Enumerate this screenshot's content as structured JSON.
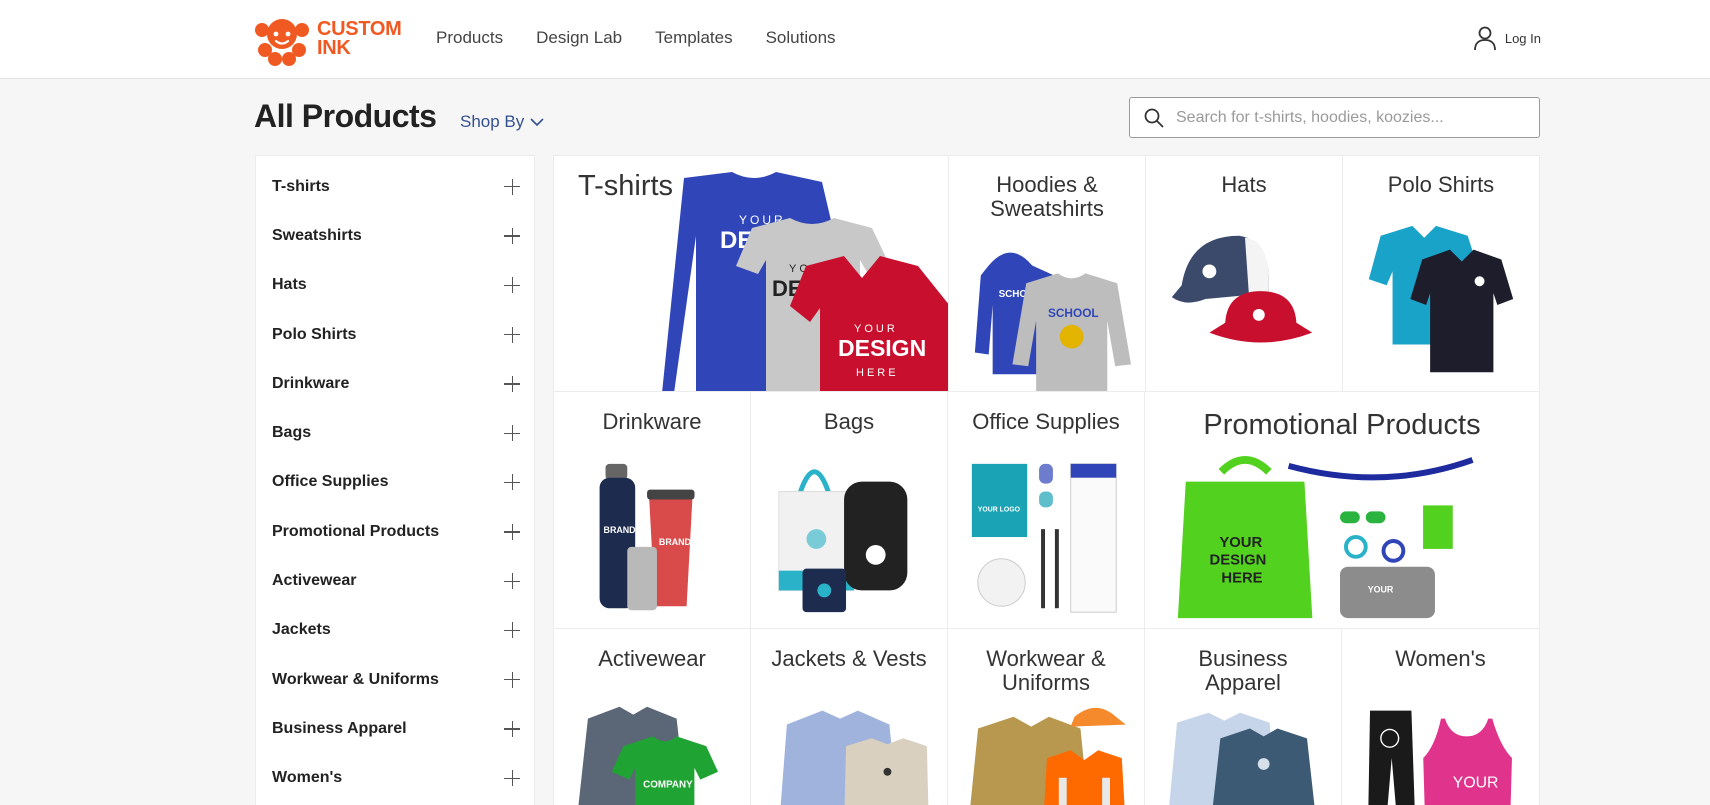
{
  "brand": {
    "logo_line1": "CUSTOM",
    "logo_line2": "INK",
    "accent": "#f05a22"
  },
  "nav": {
    "items": [
      "Products",
      "Design Lab",
      "Templates",
      "Solutions"
    ],
    "login_label": "Log In"
  },
  "page": {
    "title": "All Products",
    "shop_by": "Shop By"
  },
  "search": {
    "placeholder": "Search for t-shirts, hoodies, koozies...",
    "value": ""
  },
  "sidebar": {
    "items": [
      "T-shirts",
      "Sweatshirts",
      "Hats",
      "Polo Shirts",
      "Drinkware",
      "Bags",
      "Office Supplies",
      "Promotional Products",
      "Activewear",
      "Jackets",
      "Workwear & Uniforms",
      "Business Apparel",
      "Women's"
    ]
  },
  "tiles": {
    "tshirts": "T-shirts",
    "hoodies_line1": "Hoodies &",
    "hoodies_line2": "Sweatshirts",
    "hats": "Hats",
    "polo": "Polo Shirts",
    "drinkware": "Drinkware",
    "bags": "Bags",
    "office": "Office Supplies",
    "promo": "Promotional Products",
    "activewear": "Activewear",
    "jackets": "Jackets & Vests",
    "workwear_line1": "Workwear &",
    "workwear_line2": "Uniforms",
    "business_line1": "Business",
    "business_line2": "Apparel",
    "womens": "Women's"
  },
  "product_art_text": {
    "your": "YOUR",
    "design": "DESIGN",
    "here": "HERE",
    "school": "SCHOOL",
    "brand": "BRAND",
    "company": "COMPANY",
    "logo": "YOUR LOGO"
  },
  "colors": {
    "royal_blue": "#2f45b8",
    "heather_grey": "#c8c8c8",
    "red": "#c8102e",
    "lime": "#52d11f",
    "teal": "#1aa3c9",
    "navy": "#1d2b4f"
  }
}
